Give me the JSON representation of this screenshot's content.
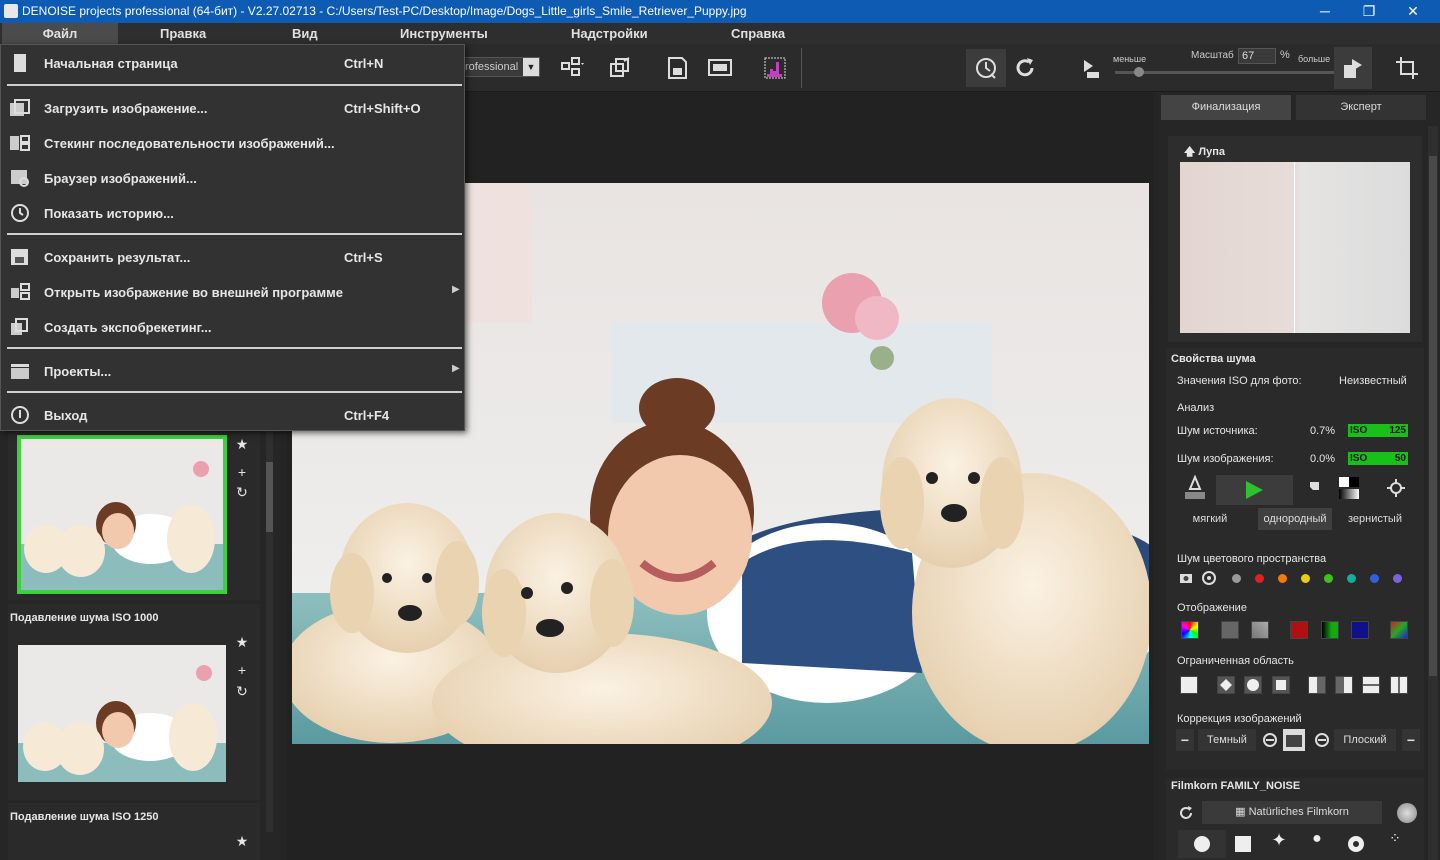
{
  "window": {
    "title": "DENOISE projects professional (64-бит) - V2.27.02713 - C:/Users/Test-PC/Desktop/Image/Dogs_Little_girls_Smile_Retriever_Puppy.jpg",
    "minimize": "─",
    "maximize": "❐",
    "close": "✕"
  },
  "menubar": {
    "items": [
      {
        "label": "Файл"
      },
      {
        "label": "Правка"
      },
      {
        "label": "Вид"
      },
      {
        "label": "Инструменты"
      },
      {
        "label": "Надстройки"
      },
      {
        "label": "Справка"
      }
    ]
  },
  "file_menu": {
    "items": [
      {
        "label": "Начальная страница",
        "shortcut": "Ctrl+N",
        "icon": "page-icon"
      },
      {
        "label": "Загрузить изображение...",
        "shortcut": "Ctrl+Shift+O",
        "icon": "open-image-icon"
      },
      {
        "label": "Стекинг последовательности изображений...",
        "shortcut": "",
        "icon": "stacking-icon"
      },
      {
        "label": "Браузер изображений...",
        "shortcut": "",
        "icon": "image-browser-icon"
      },
      {
        "label": "Показать историю...",
        "shortcut": "",
        "icon": "history-icon"
      },
      {
        "label": "Сохранить результат...",
        "shortcut": "Ctrl+S",
        "icon": "save-icon"
      },
      {
        "label": "Открыть изображение во внешней программе",
        "shortcut": "",
        "icon": "external-program-icon",
        "submenu": true
      },
      {
        "label": "Создать экспобрекетинг...",
        "shortcut": "",
        "icon": "exposure-bracketing-icon"
      },
      {
        "label": "Проекты...",
        "shortcut": "",
        "icon": "projects-icon",
        "submenu": true
      },
      {
        "label": "Выход",
        "shortcut": "Ctrl+F4",
        "icon": "exit-icon"
      }
    ]
  },
  "toolbar": {
    "preset_value": "rofessional",
    "zoom_less": "меньше",
    "zoom_label": "Масштаб",
    "zoom_value": "67",
    "zoom_unit": "%",
    "zoom_more": "больше",
    "zoom_slider_fraction": 0.05
  },
  "presets": [
    {
      "title": "Подавление шума ISO 1000",
      "selected": false
    },
    {
      "title": "Подавление шума ISO 1250",
      "selected": false
    }
  ],
  "right_panel": {
    "tabs": [
      {
        "label": "Финализация"
      },
      {
        "label": "Эксперт"
      }
    ],
    "loupe_title": "Лупа",
    "noise_props_title": "Свойства шума",
    "iso_label": "Значения ISO для фото:",
    "iso_value": "Неизвестный",
    "analysis_label": "Анализ",
    "source_noise_label": "Шум источника:",
    "source_noise_value": "0.7%",
    "source_iso_tag": "ISO",
    "source_iso_value": "125",
    "image_noise_label": "Шум изображения:",
    "image_noise_value": "0.0%",
    "image_iso_tag": "ISO",
    "image_iso_value": "50",
    "grain_modes": [
      "мягкий",
      "однородный",
      "зернистый"
    ],
    "color_space_label": "Шум цветового пространства",
    "color_dots": [
      "#9a9a9a",
      "#e02020",
      "#f07a10",
      "#e8d010",
      "#40c020",
      "#10b0a0",
      "#3060e0",
      "#8060e0"
    ],
    "display_label": "Отображение",
    "restricted_area_label": "Ограниченная область",
    "correction_label": "Коррекция изображений",
    "correction_dark": "Темный",
    "correction_flat": "Плоский",
    "correction_minus": "−",
    "filmkorn_title": "Filmkorn FAMILY_NOISE",
    "filmkorn_value": "Natürliches Filmkorn"
  },
  "colors": {
    "titlebar": "#0d5bb3",
    "accent_green": "#3dd13d",
    "iso_green": "#17c117"
  }
}
